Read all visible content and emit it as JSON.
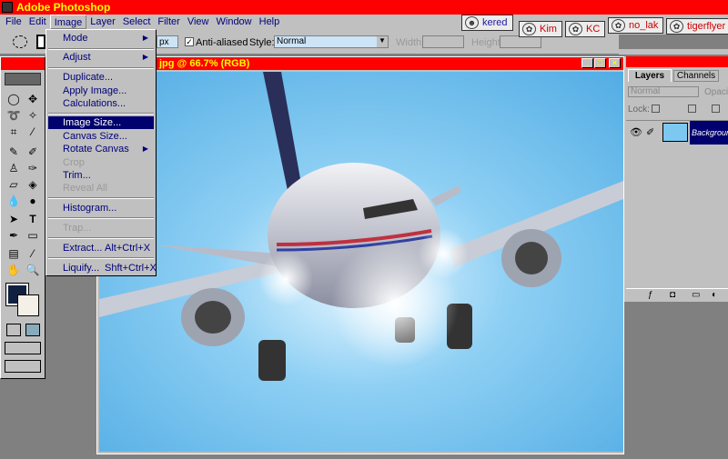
{
  "app": {
    "title": "Adobe Photoshop"
  },
  "menubar": [
    "File",
    "Edit",
    "Image",
    "Layer",
    "Select",
    "Filter",
    "View",
    "Window",
    "Help"
  ],
  "options": {
    "feather_value": "px",
    "anti_aliased": "Anti-aliased",
    "style_label": "Style:",
    "style_value": "Normal",
    "width_label": "Width:",
    "height_label": "Height:"
  },
  "user_tabs": [
    {
      "name": "kered"
    },
    {
      "name": "Kim"
    },
    {
      "name": "KC"
    },
    {
      "name": "no_lak"
    },
    {
      "name": "tigerflyer"
    }
  ],
  "document": {
    "title": "jpg @ 66.7% (RGB)"
  },
  "image_menu": {
    "items": [
      {
        "label": "Mode",
        "submenu": true
      },
      {
        "label": "Adjust",
        "submenu": true
      },
      {
        "label": "Duplicate..."
      },
      {
        "label": "Apply Image..."
      },
      {
        "label": "Calculations..."
      },
      {
        "label": "Image Size...",
        "highlighted": true
      },
      {
        "label": "Canvas Size..."
      },
      {
        "label": "Rotate Canvas",
        "submenu": true
      },
      {
        "label": "Crop",
        "disabled": true
      },
      {
        "label": "Trim..."
      },
      {
        "label": "Reveal All",
        "disabled": true
      },
      {
        "label": "Histogram..."
      },
      {
        "label": "Trap...",
        "disabled": true
      },
      {
        "label": "Extract...",
        "shortcut": "Alt+Ctrl+X"
      },
      {
        "label": "Liquify...",
        "shortcut": "Shft+Ctrl+X"
      }
    ]
  },
  "layers_panel": {
    "tabs": [
      "Layers",
      "Channels"
    ],
    "blend_mode": "Normal",
    "opacity_label": "Opacity",
    "lock_label": "Lock:",
    "layer_name": "Background"
  },
  "colors": {
    "titlebar": "#ff0000",
    "highlight": "#00006e",
    "sky": "#6cc0ee"
  }
}
